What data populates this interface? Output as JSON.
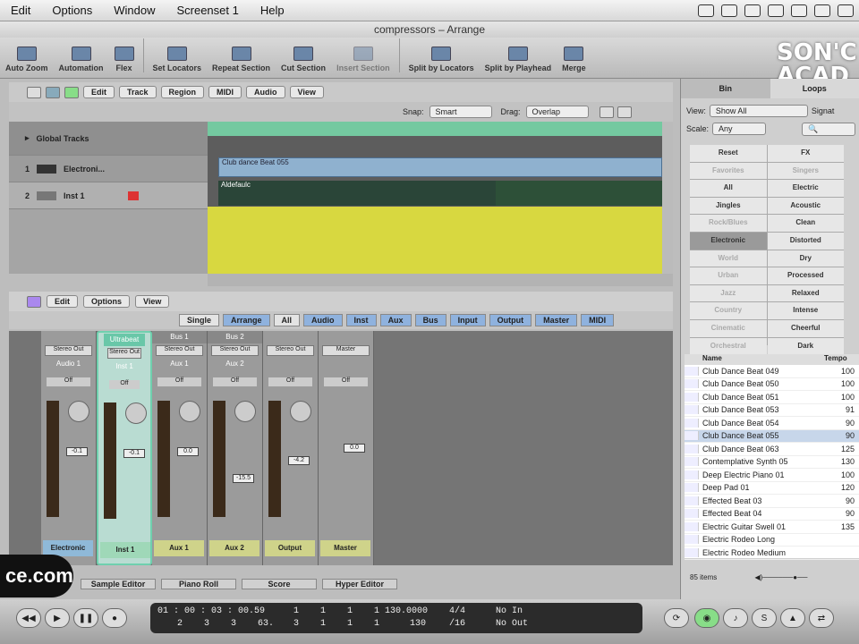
{
  "menubar": {
    "items": [
      "Edit",
      "Options",
      "Window",
      "Screenset 1",
      "Help"
    ]
  },
  "title": "compressors – Arrange",
  "toolbar": {
    "items": [
      "Auto Zoom",
      "Automation",
      "Flex",
      "Set Locators",
      "Repeat Section",
      "Cut Section",
      "Insert Section",
      "Split by Locators",
      "Split by Playhead",
      "Merge"
    ]
  },
  "logo": "SON'C ACAD",
  "arrange": {
    "menus": [
      "Edit",
      "Track",
      "Region",
      "MIDI",
      "Audio",
      "View"
    ],
    "snap_label": "Snap:",
    "snap": "Smart",
    "drag_label": "Drag:",
    "drag": "Overlap",
    "global_tracks": "Global Tracks",
    "tracks": [
      {
        "num": "1",
        "name": "Electroni..."
      },
      {
        "num": "2",
        "name": "Inst 1"
      }
    ],
    "region1": "Club dance Beat 055",
    "region2": "Aldefaulc"
  },
  "mixer": {
    "menus": [
      "Edit",
      "Options",
      "View"
    ],
    "views": [
      "Single",
      "Arrange",
      "All"
    ],
    "filters": [
      "Audio",
      "Inst",
      "Aux",
      "Bus",
      "Input",
      "Output",
      "Master",
      "MIDI"
    ],
    "strips": [
      {
        "top": "",
        "io": "Stereo Out",
        "sub": "Audio 1",
        "off": "Off",
        "fader": "-0.1",
        "name": "Electronic"
      },
      {
        "top": "Ultrabeat",
        "io": "Stereo Out",
        "sub": "Inst 1",
        "off": "Off",
        "fader": "-0.1",
        "name": "Inst 1"
      },
      {
        "top": "Bus 1",
        "io": "Stereo Out",
        "sub": "Aux 1",
        "off": "Off",
        "fader": "0.0",
        "name": "Aux 1"
      },
      {
        "top": "Bus 2",
        "io": "Stereo Out",
        "sub": "Aux 2",
        "off": "Off",
        "fader": "-15.5",
        "name": "Aux 2"
      },
      {
        "top": "",
        "io": "Stereo Out",
        "sub": "",
        "off": "Off",
        "fader": "-4.2",
        "name": "Output"
      },
      {
        "top": "",
        "io": "Master",
        "sub": "",
        "off": "Off",
        "fader": "0.0",
        "name": "Master"
      }
    ]
  },
  "bottom_tabs": [
    "Sample Editor",
    "Piano Roll",
    "Score",
    "Hyper Editor"
  ],
  "brand": "ce.com",
  "transport": {
    "time": "01 : 00 : 03 : 00.59",
    "bars": "2    3    3    63.",
    "pos": "1    1    1    1",
    "pos2": "3    1    1    1",
    "tempo": "130.0000",
    "tempo2": "130",
    "sig": "4/4",
    "div": "/16",
    "in": "No In",
    "out": "No Out"
  },
  "browser": {
    "tabs": [
      "Bin",
      "Loops"
    ],
    "view_label": "View:",
    "view": "Show All",
    "scale_label": "Scale:",
    "scale": "Any",
    "signature": "Signat",
    "keywords": [
      [
        "Reset",
        "FX"
      ],
      [
        "Favorites",
        "Singers"
      ],
      [
        "All",
        "Electric"
      ],
      [
        "Jingles",
        "Acoustic"
      ],
      [
        "Rock/Blues",
        "Clean"
      ],
      [
        "Electronic",
        "Distorted"
      ],
      [
        "World",
        "Dry"
      ],
      [
        "Urban",
        "Processed"
      ],
      [
        "Jazz",
        "Relaxed"
      ],
      [
        "Country",
        "Intense"
      ],
      [
        "Cinematic",
        "Cheerful"
      ],
      [
        "Orchestral",
        "Dark"
      ]
    ],
    "col_name": "Name",
    "col_tempo": "Tempo",
    "results": [
      [
        "Club Dance Beat 049",
        "100"
      ],
      [
        "Club Dance Beat 050",
        "100"
      ],
      [
        "Club Dance Beat 051",
        "100"
      ],
      [
        "Club Dance Beat 053",
        "91"
      ],
      [
        "Club Dance Beat 054",
        "90"
      ],
      [
        "Club Dance Beat 055",
        "90"
      ],
      [
        "Club Dance Beat 063",
        "125"
      ],
      [
        "Contemplative Synth 05",
        "130"
      ],
      [
        "Deep Electric Piano 01",
        "100"
      ],
      [
        "Deep Pad 01",
        "120"
      ],
      [
        "Effected Beat 03",
        "90"
      ],
      [
        "Effected Beat 04",
        "90"
      ],
      [
        "Electric Guitar Swell 01",
        "135"
      ],
      [
        "Electric Rodeo Long",
        ""
      ],
      [
        "Electric Rodeo Medium",
        ""
      ]
    ],
    "items_count": "85 items"
  }
}
